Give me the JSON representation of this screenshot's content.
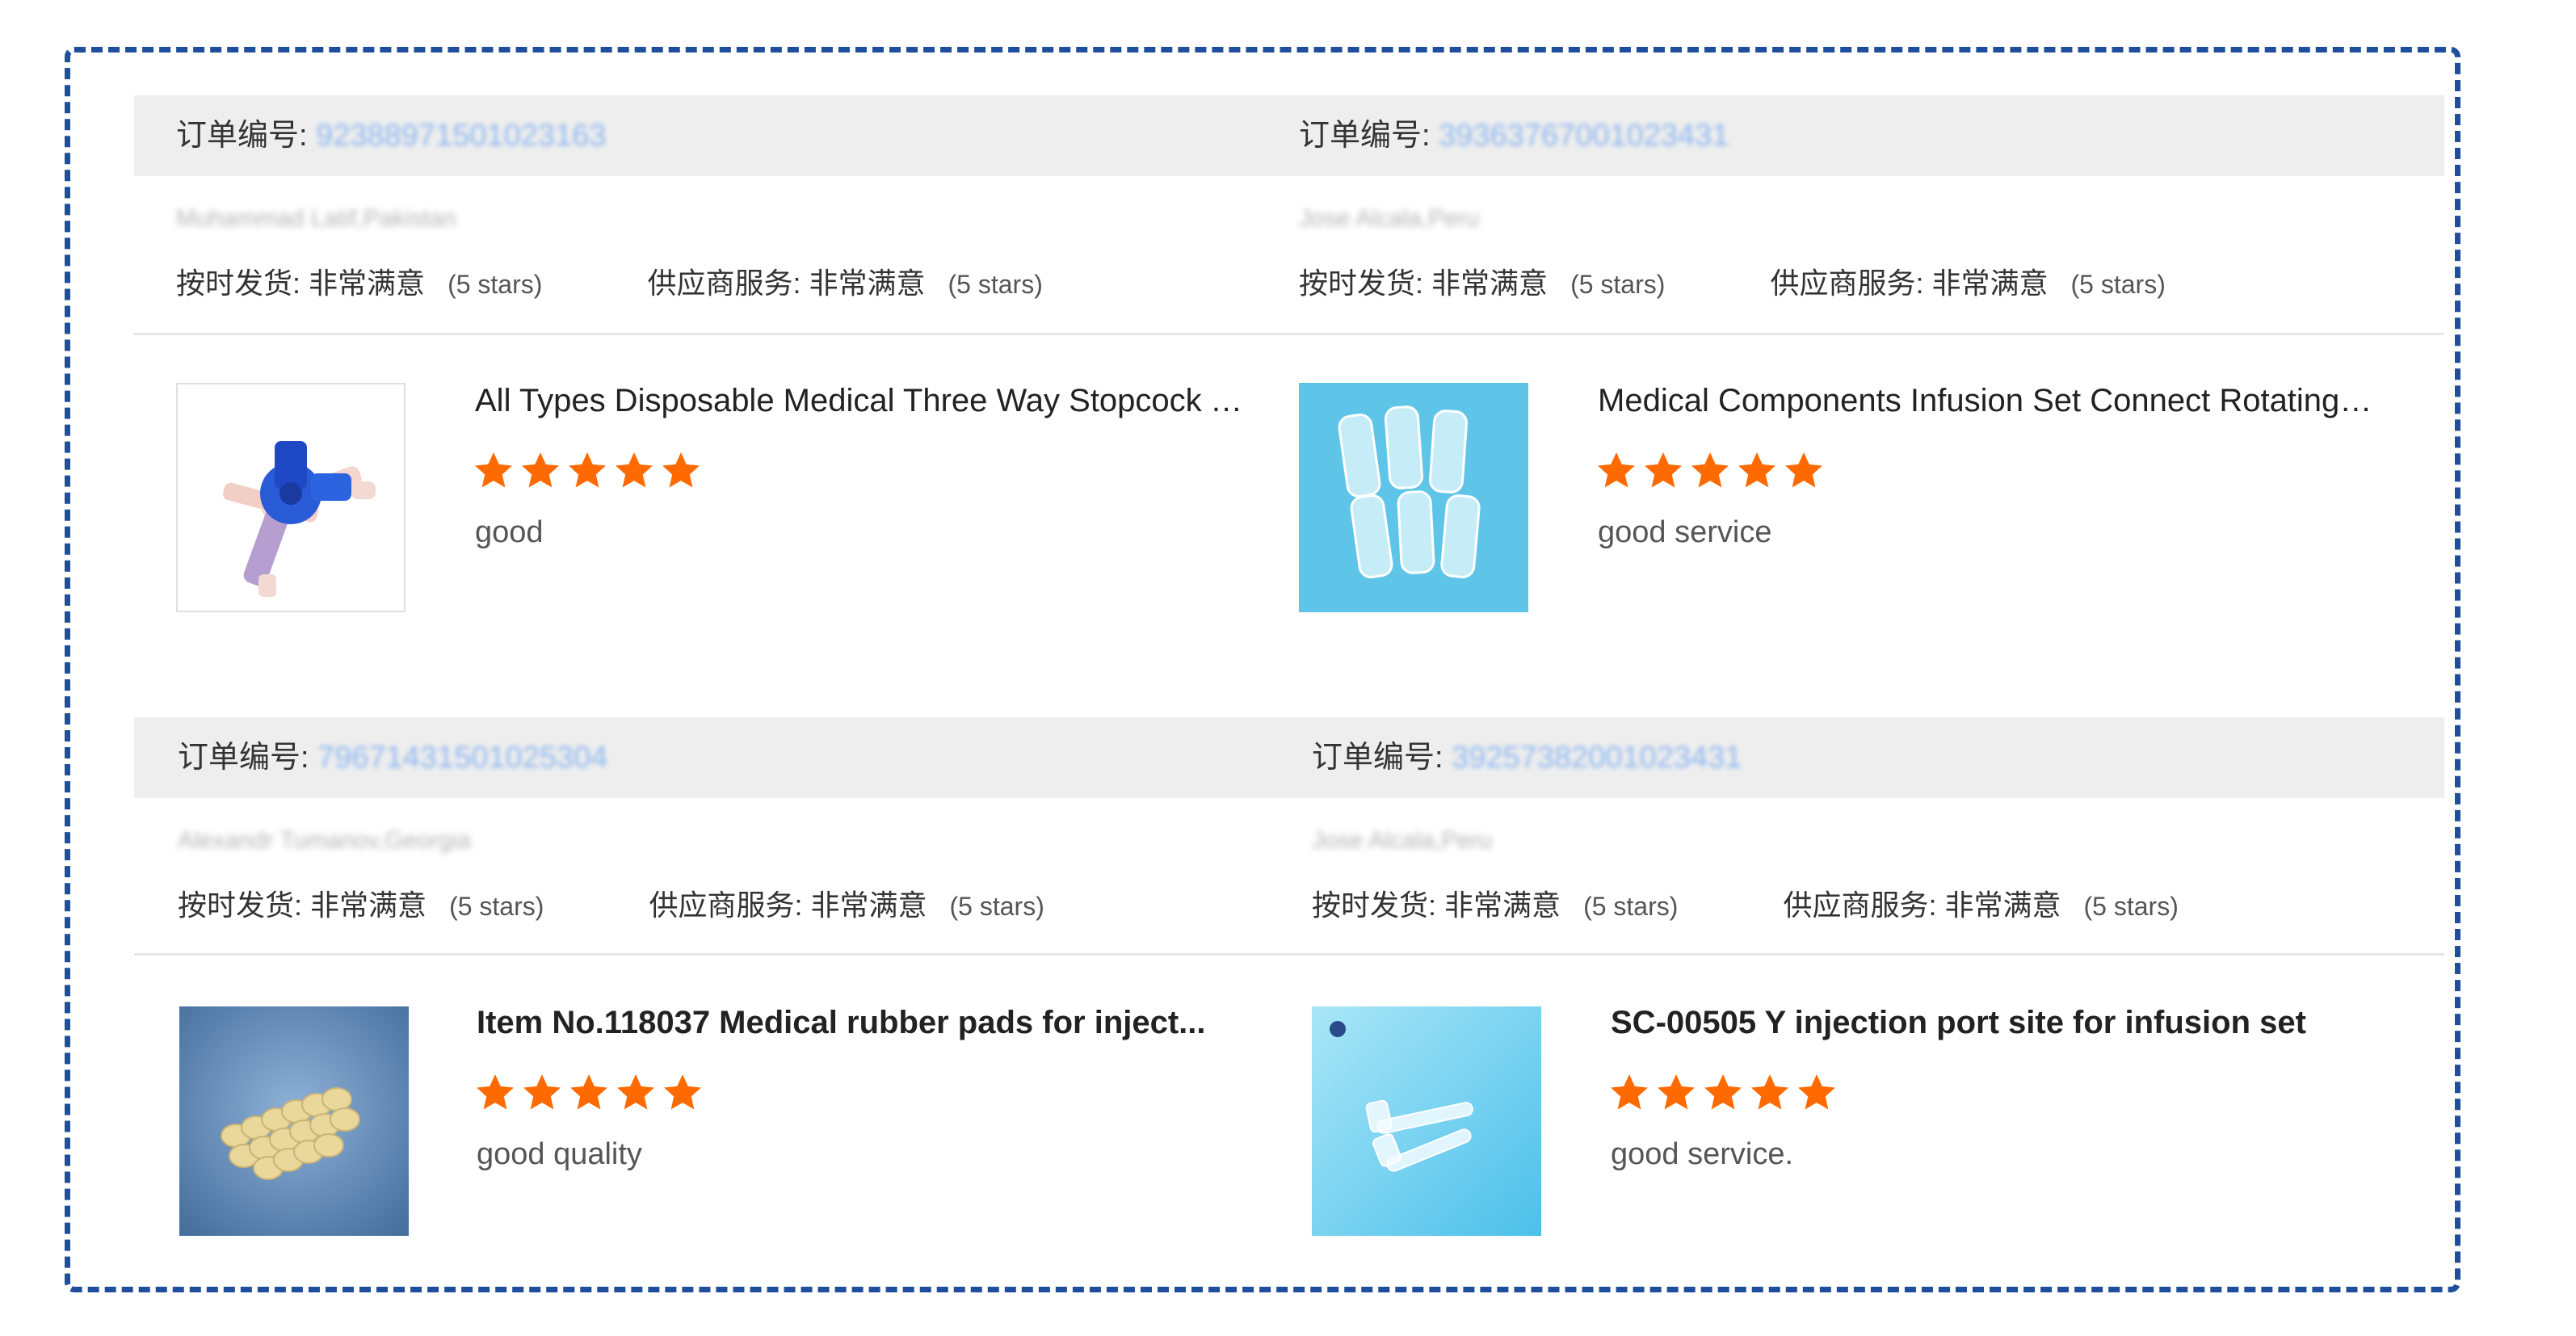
{
  "colors": {
    "frame": "#1f4e9c",
    "star": "#ff6a00",
    "header_bg": "#eeeeee",
    "order_number": "#8cb6f0"
  },
  "reviews": [
    {
      "order_label": "订单编号:",
      "order_number": "92388971501023163",
      "buyer": "Muhammad Latif,Pakistan",
      "ontime_label": "按时发货:",
      "ontime_value": "非常满意",
      "ontime_stars": "(5 stars)",
      "service_label": "供应商服务:",
      "service_value": "非常满意",
      "service_stars": "(5 stars)",
      "product_title": "All Types Disposable Medical Three Way Stopcock T...",
      "rating": 5,
      "comment": "good",
      "thumb_icon": "stopcock-product-image"
    },
    {
      "order_label": "订单编号:",
      "order_number": "39363767001023431",
      "buyer": "Jose Alcala,Peru",
      "ontime_label": "按时发货:",
      "ontime_value": "非常满意",
      "ontime_stars": "(5 stars)",
      "service_label": "供应商服务:",
      "service_value": "非常满意",
      "service_stars": "(5 stars)",
      "product_title": "Medical Components Infusion Set Connect Rotating L...",
      "rating": 5,
      "comment": "good service",
      "thumb_icon": "connector-product-image"
    },
    {
      "order_label": "订单编号:",
      "order_number": "79671431501025304",
      "buyer": "Alexandr Tumanov,Georgia",
      "ontime_label": "按时发货:",
      "ontime_value": "非常满意",
      "ontime_stars": "(5 stars)",
      "service_label": "供应商服务:",
      "service_value": "非常满意",
      "service_stars": "(5 stars)",
      "product_title": "Item No.118037 Medical rubber pads for inject...",
      "rating": 5,
      "comment": "good quality",
      "thumb_icon": "rubber-pads-product-image"
    },
    {
      "order_label": "订单编号:",
      "order_number": "39257382001023431",
      "buyer": "Jose Alcala,Peru",
      "ontime_label": "按时发货:",
      "ontime_value": "非常满意",
      "ontime_stars": "(5 stars)",
      "service_label": "供应商服务:",
      "service_value": "非常满意",
      "service_stars": "(5 stars)",
      "product_title": "SC-00505 Y injection port site for infusion set",
      "rating": 5,
      "comment": "good service.",
      "thumb_icon": "y-port-product-image"
    }
  ]
}
